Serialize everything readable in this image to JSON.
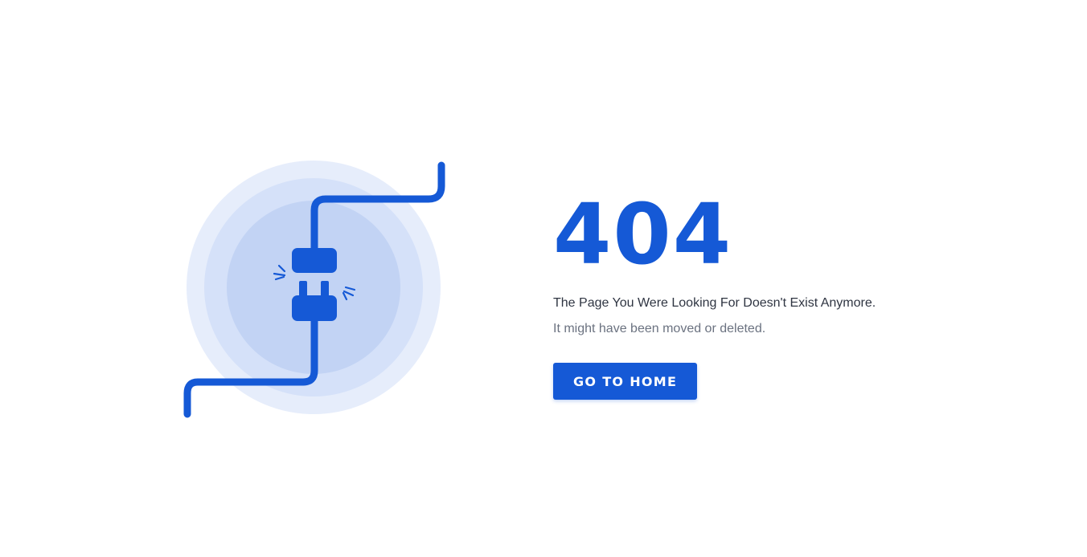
{
  "error": {
    "code": "404",
    "headline": "The Page You Were Looking For Doesn't Exist Anymore.",
    "subtext": "It might have been moved or deleted."
  },
  "actions": {
    "home_label": "GO TO HOME"
  },
  "illustration": {
    "icon": "unplugged-cable-icon",
    "accent_color": "#1559d6",
    "ring_colors": [
      "#e6edfb",
      "#d5e1f9",
      "#c2d3f4"
    ]
  }
}
